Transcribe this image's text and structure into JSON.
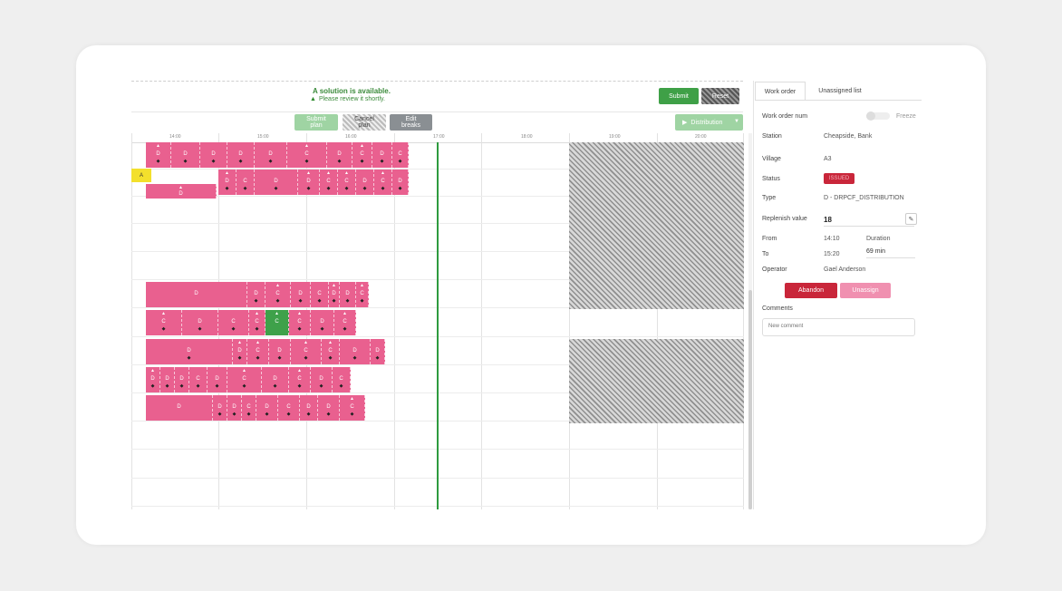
{
  "banner": {
    "title": "A solution is available.",
    "subtitle": "Please review it shortly.",
    "warning_icon": "warning-triangle-icon"
  },
  "toolbar": {
    "submit_label": "Submit",
    "reset_label": "Reset",
    "submit_plan_label": "Submit plan",
    "ghost_label": "Cancel plan",
    "edit_breaks_label": "Edit breaks",
    "distribution_label": "Distribution"
  },
  "colors": {
    "task": "#e9608f",
    "task_selected": "#3ea14a",
    "now_line": "#2e9b3e",
    "submit": "#3fa047",
    "abandon": "#c9263a",
    "unassign": "#f090b0"
  },
  "timeline": {
    "ticks": [
      "14:00",
      "15:00",
      "16:00",
      "17:00",
      "18:00",
      "19:00",
      "20:00"
    ]
  },
  "gantt": {
    "yellow_tag": "A",
    "rows": [
      [
        {
          "l": "D",
          "t": true,
          "d": true
        },
        {
          "l": "D",
          "t": false,
          "d": true
        },
        {
          "l": "D",
          "t": false,
          "d": true
        },
        {
          "l": "D",
          "t": false,
          "d": true
        },
        {
          "l": "D",
          "t": false,
          "d": true
        },
        {
          "l": "C",
          "t": true,
          "d": true
        },
        {
          "l": "D",
          "t": false,
          "d": true
        },
        {
          "l": "C",
          "t": true,
          "d": true
        },
        {
          "l": "D",
          "t": false,
          "d": true
        },
        {
          "l": "C",
          "t": false,
          "d": true
        }
      ],
      [
        {
          "l": "D",
          "t": true,
          "d": true
        },
        {
          "l": "C",
          "t": false,
          "d": true
        },
        {
          "l": "D",
          "t": false,
          "d": true
        },
        {
          "l": "D",
          "t": true,
          "d": true
        },
        {
          "l": "C",
          "t": true,
          "d": true
        },
        {
          "l": "C",
          "t": true,
          "d": true
        },
        {
          "l": "D",
          "t": false,
          "d": true
        },
        {
          "l": "C",
          "t": true,
          "d": true
        },
        {
          "l": "D",
          "t": false,
          "d": true
        }
      ],
      [
        {
          "l": "D",
          "t": true,
          "d": false
        }
      ],
      [
        {
          "l": "D",
          "t": false,
          "d": false
        },
        {
          "l": "D",
          "t": false,
          "d": true
        },
        {
          "l": "C",
          "t": true,
          "d": true
        },
        {
          "l": "D",
          "t": false,
          "d": true
        },
        {
          "l": "C",
          "t": false,
          "d": true
        },
        {
          "l": "D",
          "t": true,
          "d": true
        },
        {
          "l": "D",
          "t": false,
          "d": true
        },
        {
          "l": "C",
          "t": true,
          "d": true
        }
      ],
      [
        {
          "l": "C",
          "t": true,
          "d": true
        },
        {
          "l": "D",
          "t": false,
          "d": true
        },
        {
          "l": "C",
          "t": false,
          "d": true
        },
        {
          "l": "C",
          "t": true,
          "d": true
        },
        {
          "l": "C",
          "t": true,
          "d": false,
          "g": true
        },
        {
          "l": "C",
          "t": true,
          "d": true
        },
        {
          "l": "D",
          "t": false,
          "d": true
        },
        {
          "l": "C",
          "t": true,
          "d": true
        }
      ],
      [
        {
          "l": "D",
          "t": false,
          "d": true
        },
        {
          "l": "D",
          "t": true,
          "d": true
        },
        {
          "l": "C",
          "t": true,
          "d": true
        },
        {
          "l": "D",
          "t": false,
          "d": true
        },
        {
          "l": "C",
          "t": true,
          "d": true
        },
        {
          "l": "C",
          "t": true,
          "d": true
        },
        {
          "l": "D",
          "t": false,
          "d": true
        },
        {
          "l": "D",
          "t": false,
          "d": true
        }
      ],
      [
        {
          "l": "D",
          "t": true,
          "d": true
        },
        {
          "l": "D",
          "t": false,
          "d": true
        },
        {
          "l": "D",
          "t": false,
          "d": true
        },
        {
          "l": "C",
          "t": false,
          "d": true
        },
        {
          "l": "D",
          "t": false,
          "d": true
        },
        {
          "l": "C",
          "t": true,
          "d": true
        },
        {
          "l": "D",
          "t": false,
          "d": true
        },
        {
          "l": "C",
          "t": true,
          "d": true
        },
        {
          "l": "D",
          "t": false,
          "d": true
        },
        {
          "l": "C",
          "t": false,
          "d": true
        }
      ],
      [
        {
          "l": "D",
          "t": false,
          "d": false
        },
        {
          "l": "D",
          "t": false,
          "d": true
        },
        {
          "l": "D",
          "t": false,
          "d": true
        },
        {
          "l": "C",
          "t": false,
          "d": true
        },
        {
          "l": "D",
          "t": false,
          "d": true
        },
        {
          "l": "C",
          "t": false,
          "d": true
        },
        {
          "l": "D",
          "t": false,
          "d": true
        },
        {
          "l": "D",
          "t": false,
          "d": true
        },
        {
          "l": "C",
          "t": true,
          "d": true
        }
      ]
    ]
  },
  "panel": {
    "tab_work_order": "Work order",
    "tab_unassigned": "Unassigned list",
    "work_order_num_label": "Work order num",
    "freeze_label": "Freeze",
    "station_label": "Station",
    "station_value": "Cheapside, Bank",
    "village_label": "Village",
    "village_value": "A3",
    "status_label": "Status",
    "status_value": "ISSUED",
    "type_label": "Type",
    "type_value": "D - DRPCF_DISTRIBUTION",
    "replenish_label": "Replenish value",
    "replenish_value": "18",
    "from_label": "From",
    "from_value": "14:10",
    "duration_label": "Duration",
    "to_label": "To",
    "to_value": "15:20",
    "duration_value": "69 min",
    "operator_label": "Operator",
    "operator_value": "Gael Anderson",
    "abandon_label": "Abandon",
    "unassign_label": "Unassign",
    "comments_label": "Comments",
    "comment_placeholder": "New comment"
  }
}
